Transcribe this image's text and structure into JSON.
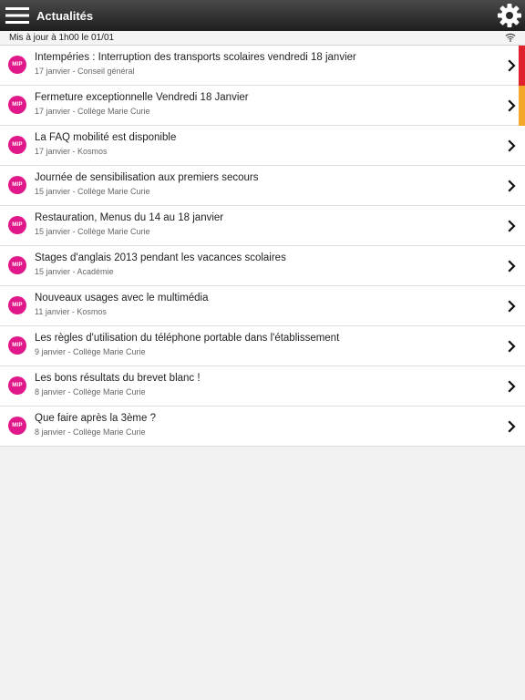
{
  "header": {
    "title": "Actualités",
    "menu_icon": "hamburger-icon",
    "settings_icon": "gear-icon"
  },
  "status": {
    "updated_text": "Mis à jour à 1h00 le 01/01",
    "wifi_icon": "wifi-icon"
  },
  "colors": {
    "brand": "#e0188a",
    "priority_red": "#e0212b",
    "priority_orange": "#f4a72b"
  },
  "news": [
    {
      "title": "Intempéries : Interruption des transports scolaires vendredi 18 janvier",
      "meta": "17 janvier - Conseil général",
      "logo": "MIP",
      "priority": "red"
    },
    {
      "title": "Fermeture exceptionnelle Vendredi 18 Janvier",
      "meta": "17 janvier - Collège Marie Curie",
      "logo": "MIP",
      "priority": "orange"
    },
    {
      "title": "La FAQ mobilité est disponible",
      "meta": "17 janvier - Kosmos",
      "logo": "MIP",
      "priority": ""
    },
    {
      "title": "Journée de sensibilisation aux premiers secours",
      "meta": "15 janvier - Collège Marie Curie",
      "logo": "MIP",
      "priority": ""
    },
    {
      "title": "Restauration, Menus du 14 au 18 janvier",
      "meta": "15 janvier - Collège Marie Curie",
      "logo": "MIP",
      "priority": ""
    },
    {
      "title": "Stages d'anglais 2013 pendant les vacances scolaires",
      "meta": "15 janvier - Académie",
      "logo": "MIP",
      "priority": ""
    },
    {
      "title": "Nouveaux usages avec le multimédia",
      "meta": "11 janvier - Kosmos",
      "logo": "MIP",
      "priority": ""
    },
    {
      "title": "Les règles d'utilisation du téléphone portable dans l'établissement",
      "meta": "9 janvier - Collège Marie Curie",
      "logo": "MIP",
      "priority": ""
    },
    {
      "title": "Les bons résultats du brevet blanc !",
      "meta": "8 janvier - Collège Marie Curie",
      "logo": "MIP",
      "priority": ""
    },
    {
      "title": "Que faire après la 3ème ?",
      "meta": "8 janvier - Collège Marie Curie",
      "logo": "MIP",
      "priority": ""
    }
  ]
}
